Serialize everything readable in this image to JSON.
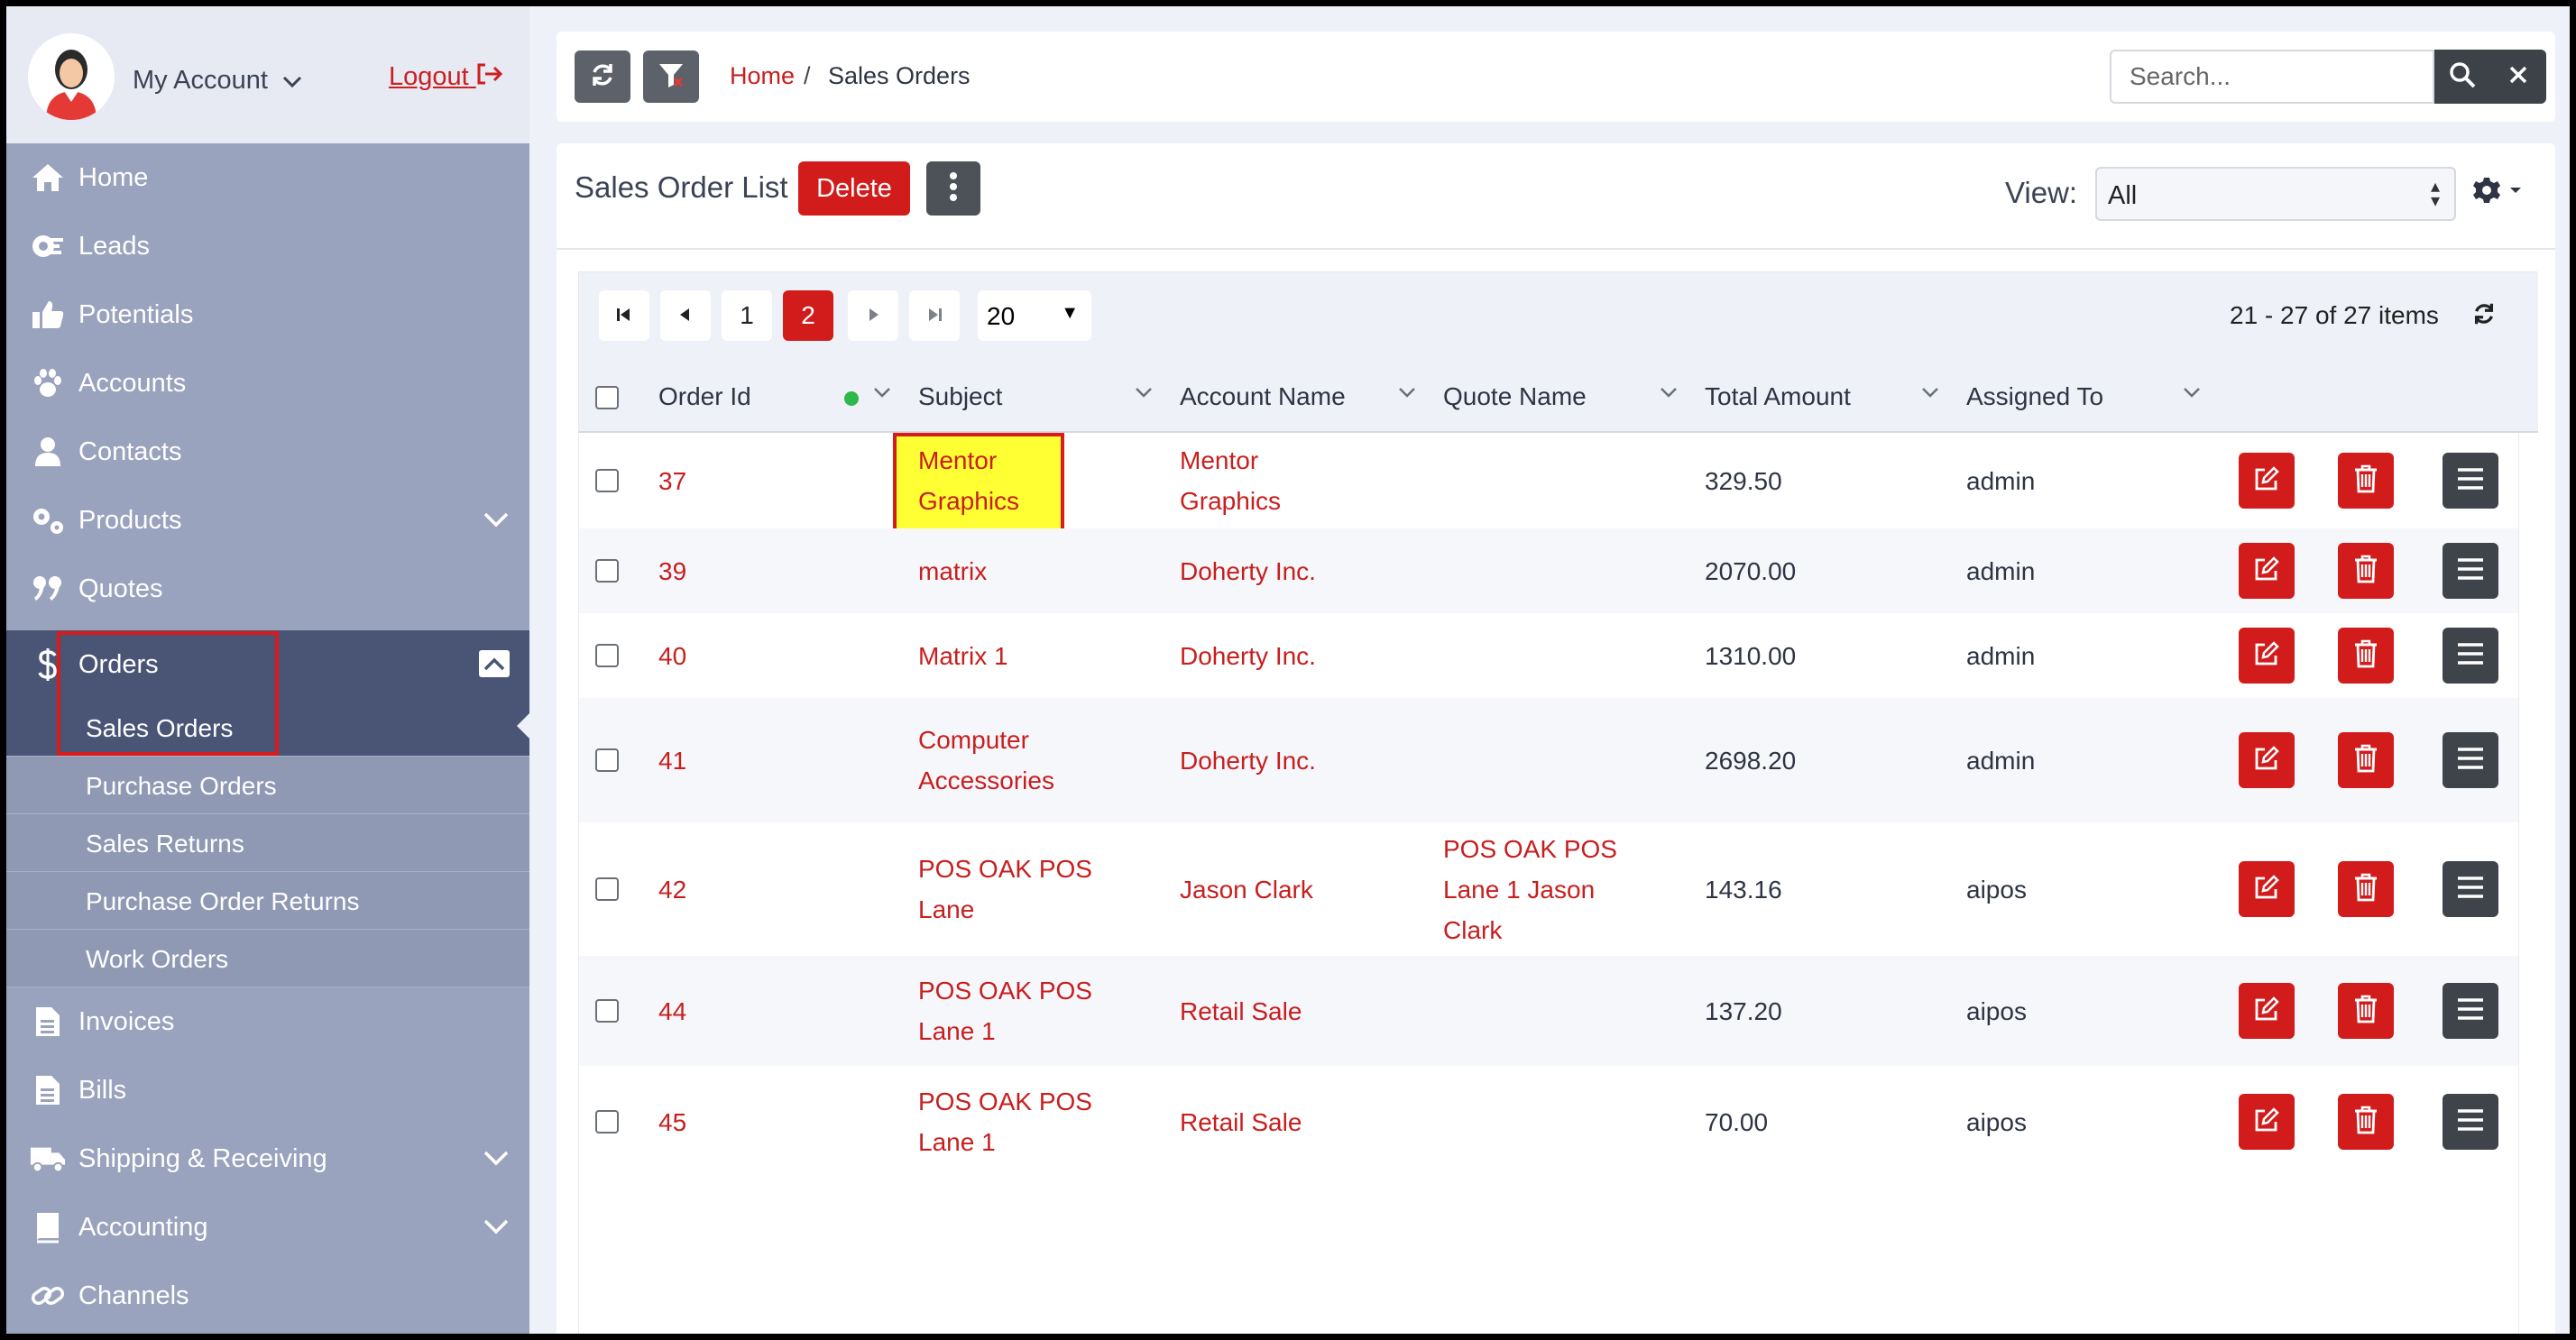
{
  "sidebar": {
    "account_label": "My Account",
    "logout_label": "Logout",
    "items": [
      {
        "label": "Home",
        "icon": "home-icon"
      },
      {
        "label": "Leads",
        "icon": "leads-icon"
      },
      {
        "label": "Potentials",
        "icon": "thumbs-up-icon"
      },
      {
        "label": "Accounts",
        "icon": "paw-icon"
      },
      {
        "label": "Contacts",
        "icon": "user-icon"
      },
      {
        "label": "Products",
        "icon": "gears-icon"
      },
      {
        "label": "Quotes",
        "icon": "quote-icon"
      },
      {
        "label": "Orders",
        "icon": "dollar-icon"
      },
      {
        "label": "Invoices",
        "icon": "document-icon"
      },
      {
        "label": "Bills",
        "icon": "document-icon"
      },
      {
        "label": "Shipping & Receiving",
        "icon": "truck-icon"
      },
      {
        "label": "Accounting",
        "icon": "book-icon"
      },
      {
        "label": "Channels",
        "icon": "link-icon"
      }
    ],
    "orders_sub": [
      {
        "label": "Sales Orders"
      },
      {
        "label": "Purchase Orders"
      },
      {
        "label": "Sales Returns"
      },
      {
        "label": "Purchase Order Returns"
      },
      {
        "label": "Work Orders"
      }
    ]
  },
  "topbar": {
    "breadcrumb_home": "Home",
    "breadcrumb_sep": "/",
    "breadcrumb_current": "Sales Orders",
    "search_placeholder": "Search..."
  },
  "list": {
    "title": "Sales Order List",
    "delete_label": "Delete",
    "view_label": "View:",
    "view_value": "All"
  },
  "pager": {
    "pages": [
      "1",
      "2"
    ],
    "current_page": "2",
    "page_size": "20",
    "items_info": "21 - 27 of 27 items"
  },
  "columns": {
    "order_id": "Order Id",
    "subject": "Subject",
    "account_name": "Account Name",
    "quote_name": "Quote Name",
    "total_amount": "Total Amount",
    "assigned_to": "Assigned To"
  },
  "rows": [
    {
      "id": "37",
      "subject": [
        "Mentor",
        "Graphics"
      ],
      "account": [
        "Mentor",
        "Graphics"
      ],
      "quote": [],
      "total": "329.50",
      "assigned": "admin"
    },
    {
      "id": "39",
      "subject": [
        "matrix"
      ],
      "account": [
        "Doherty Inc."
      ],
      "quote": [],
      "total": "2070.00",
      "assigned": "admin"
    },
    {
      "id": "40",
      "subject": [
        "Matrix 1"
      ],
      "account": [
        "Doherty Inc."
      ],
      "quote": [],
      "total": "1310.00",
      "assigned": "admin"
    },
    {
      "id": "41",
      "subject": [
        "Computer",
        "Accessories"
      ],
      "account": [
        "Doherty Inc."
      ],
      "quote": [],
      "total": "2698.20",
      "assigned": "admin"
    },
    {
      "id": "42",
      "subject": [
        "POS OAK POS",
        "Lane"
      ],
      "account": [
        "Jason Clark"
      ],
      "quote": [
        "POS OAK POS",
        "Lane 1 Jason",
        "Clark"
      ],
      "total": "143.16",
      "assigned": "aipos"
    },
    {
      "id": "44",
      "subject": [
        "POS OAK POS",
        "Lane 1"
      ],
      "account": [
        "Retail Sale"
      ],
      "quote": [],
      "total": "137.20",
      "assigned": "aipos"
    },
    {
      "id": "45",
      "subject": [
        "POS OAK POS",
        "Lane 1"
      ],
      "account": [
        "Retail Sale"
      ],
      "quote": [],
      "total": "70.00",
      "assigned": "aipos"
    }
  ],
  "colors": {
    "accent_red": "#d21c1c",
    "sidebar_bg": "#9aa3bd",
    "sidebar_active": "#4a5576",
    "highlight_yellow": "#ffff33"
  }
}
